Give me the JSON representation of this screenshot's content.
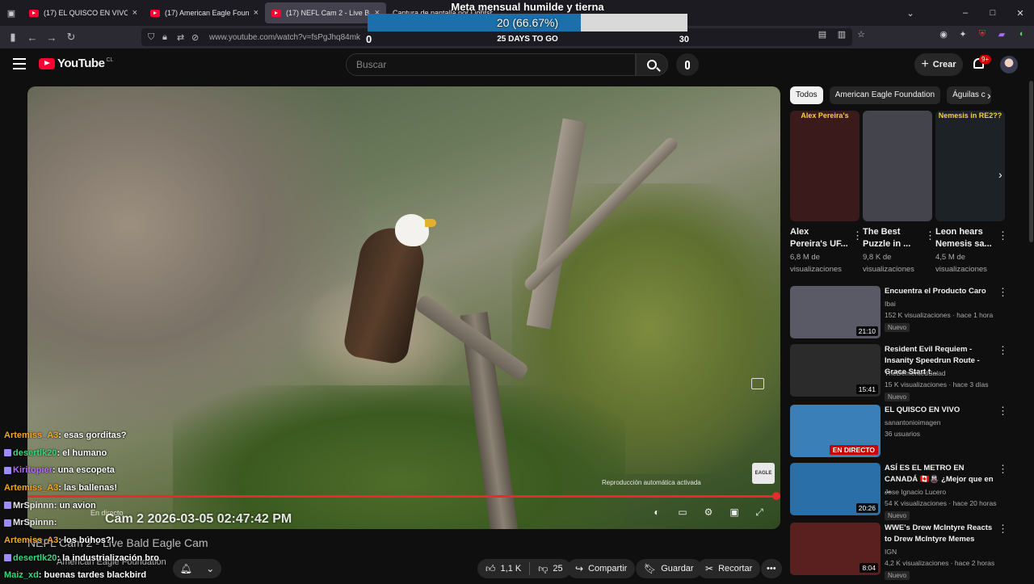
{
  "browser": {
    "tabs": [
      {
        "title": "(17) EL QUISCO EN VIVO - YouTu"
      },
      {
        "title": "(17) American Eagle Founda"
      },
      {
        "title": "(17) NEFL Cam 2 - Live Bald"
      },
      {
        "title": "Captura de pantalla por Lightsh"
      }
    ],
    "url": "www.youtube.com/watch?v=fsPgJhq84mk"
  },
  "overlay_goal": {
    "title": "Meta mensual humilde y tierna",
    "progress_text": "20 (66.67%)",
    "progress_fraction": 0.6667,
    "min": "0",
    "max": "30",
    "days_left": "25 DAYS TO GO"
  },
  "header": {
    "logo_text": "YouTube",
    "country": "CL",
    "search_placeholder": "Buscar",
    "create_label": "Crear",
    "notif_badge": "9+"
  },
  "player": {
    "autoplay_text": "Reproducción automática activada",
    "live_text": "En directo",
    "timestamp": "Cam 2 2026-03-05 02:47:42 PM",
    "logo_text": "EAGLE"
  },
  "video_info": {
    "title": "NEFL Cam 2 - Live Bald Eagle Cam",
    "channel": "American Eagle Foundation",
    "likes": "1,1 K",
    "dislikes": "25",
    "share": "Compartir",
    "save": "Guardar",
    "clip": "Recortar"
  },
  "chat": [
    {
      "user": "Artemiss_A3",
      "color": "#f5a623",
      "icon": false,
      "msg": ": esas gorditas?"
    },
    {
      "user": "desertlk20",
      "color": "#38d67a",
      "icon": true,
      "msg": ": el humano"
    },
    {
      "user": "Kiritopier",
      "color": "#b36bff",
      "icon": true,
      "msg": ": una escopeta"
    },
    {
      "user": "Artemiss_A3",
      "color": "#f5a623",
      "icon": false,
      "msg": ": las ballenas!"
    },
    {
      "user": "MrSpinnn",
      "color": "#e8e8e8",
      "icon": true,
      "msg": ": un avion"
    },
    {
      "user": "MrSpinnn",
      "color": "#e8e8e8",
      "icon": true,
      "msg": ":"
    },
    {
      "user": "Artemiss_A3",
      "color": "#f5a623",
      "icon": false,
      "msg": ": los búhos?!"
    },
    {
      "user": "desertlk20",
      "color": "#38d67a",
      "icon": true,
      "msg": ": la industrialización bro"
    },
    {
      "user": "Maiz_xd",
      "color": "#38d67a",
      "icon": false,
      "msg": ": buenas tardes blackbird"
    }
  ],
  "sidebar": {
    "chips": [
      "Todos",
      "American Eagle Foundation",
      "Águilas c"
    ],
    "shorts": [
      {
        "title": "Alex Pereira's UF...",
        "views": "6,8 M de visualizaciones",
        "overlay": "Alex Pereira's",
        "bg": "#3a1a1a"
      },
      {
        "title": "The Best Puzzle in ...",
        "views": "9,8 K de visualizaciones",
        "overlay": "",
        "bg": "#44444c"
      },
      {
        "title": "Leon hears Nemesis sa...",
        "views": "4,5 M de visualizaciones",
        "overlay": "Nemesis in RE2??",
        "bg": "#1c2226"
      }
    ],
    "videos": [
      {
        "title": "Encuentra el Producto Caro",
        "channel": "Ibai",
        "meta": "152 K visualizaciones · hace 1 hora",
        "badge": "Nuevo",
        "duration": "21:10",
        "live": false,
        "bg": "#5a5a66"
      },
      {
        "title": "Resident Evil Requiem - Insanity Speedrun Route - Grace Start t...",
        "channel": "TheDementedSalad",
        "meta": "15 K visualizaciones · hace 3 días",
        "badge": "Nuevo",
        "duration": "15:41",
        "live": false,
        "bg": "#2b2b2b"
      },
      {
        "title": "EL QUISCO EN VIVO",
        "channel": "sanantonioimagen",
        "meta": "36 usuarios",
        "badge": "",
        "duration": "EN DIRECTO",
        "live": true,
        "bg": "#3b7fb8"
      },
      {
        "title": "ASÍ ES EL METRO EN CANADÁ 🇨🇦🚇 ¿Mejor que en ...",
        "channel": "Jose Ignacio Lucero",
        "meta": "54 K visualizaciones · hace 20 horas",
        "badge": "Nuevo",
        "duration": "20:26",
        "live": false,
        "bg": "#2a6fa8"
      },
      {
        "title": "WWE's Drew McIntyre Reacts to Drew McIntyre Memes",
        "channel": "IGN",
        "meta": "4,2 K visualizaciones · hace 2 horas",
        "badge": "Nuevo",
        "duration": "8:04",
        "live": false,
        "bg": "#5a1f1f"
      }
    ]
  }
}
